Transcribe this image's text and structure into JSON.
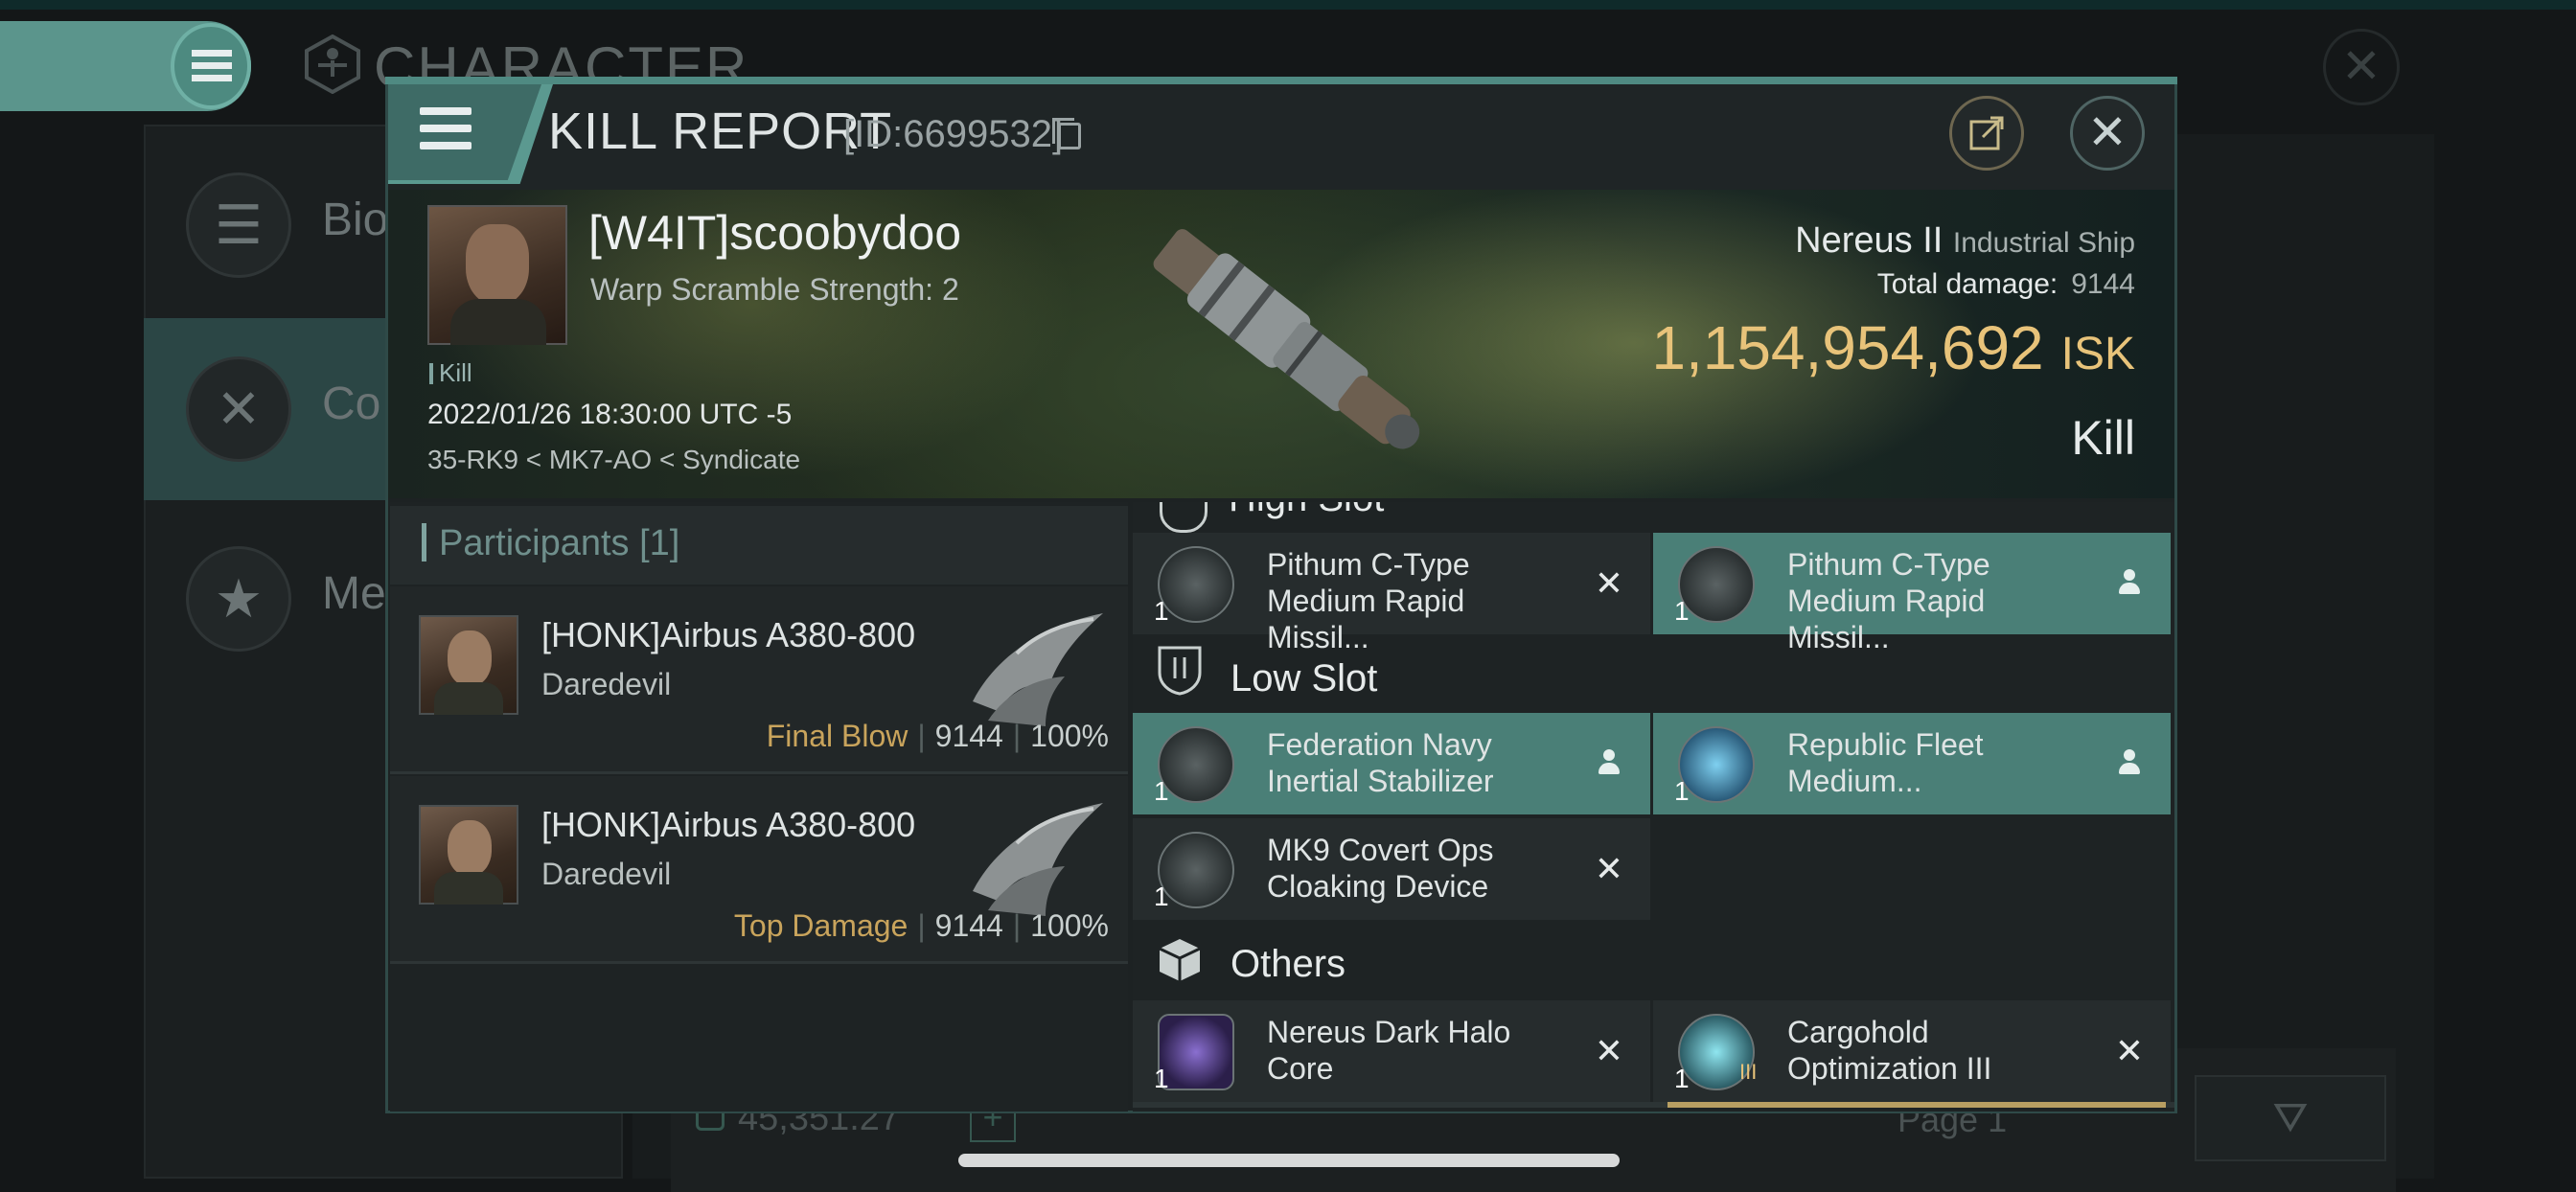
{
  "background": {
    "title": "CHARACTER",
    "sidebar": [
      {
        "label": "Bio",
        "icon": "menu-icon"
      },
      {
        "label": "Co",
        "icon": "crossed-swords-icon"
      },
      {
        "label": "Me",
        "icon": "star-icon"
      }
    ],
    "wallet_value": "45,351.27",
    "page_label": "Page 1"
  },
  "modal": {
    "title": "KILL REPORT",
    "id_text": "[ID:6699532]"
  },
  "victim": {
    "name": "[W4IT]scoobydoo",
    "scramble": "Warp Scramble Strength: 2",
    "tag": "Kill",
    "datetime": "2022/01/26 18:30:00 UTC -5",
    "location": "35-RK9 < MK7-AO < Syndicate"
  },
  "ship": {
    "name": "Nereus II",
    "class": "Industrial Ship",
    "total_damage_label": "Total damage:",
    "total_damage": "9144",
    "isk_value": "1,154,954,692",
    "isk_unit": "ISK",
    "result": "Kill"
  },
  "participants": {
    "title": "Participants",
    "count": "[1]",
    "rows": [
      {
        "name": "[HONK]Airbus A380-800",
        "ship": "Daredevil",
        "tag": "Final Blow",
        "damage": "9144",
        "percent": "100%"
      },
      {
        "name": "[HONK]Airbus A380-800",
        "ship": "Daredevil",
        "tag": "Top Damage",
        "damage": "9144",
        "percent": "100%"
      }
    ]
  },
  "fitting": {
    "high_slot_label": "High Slot",
    "high_slot": [
      {
        "name": "Pithum C-Type Medium Rapid Missil...",
        "qty": "1",
        "state": "destroyed"
      },
      {
        "name": "Pithum C-Type Medium Rapid Missil...",
        "qty": "1",
        "state": "dropped"
      }
    ],
    "low_slot_label": "Low Slot",
    "low_slot": [
      {
        "name": "Federation Navy Inertial Stabilizer",
        "qty": "1",
        "state": "dropped"
      },
      {
        "name": "Republic Fleet Medium...",
        "qty": "1",
        "state": "dropped"
      },
      {
        "name": "MK9 Covert Ops Cloaking Device",
        "qty": "1",
        "state": "destroyed"
      }
    ],
    "others_label": "Others",
    "others": [
      {
        "name": "Nereus Dark Halo Core",
        "qty": "1",
        "state": "destroyed"
      },
      {
        "name": "Cargohold Optimization III",
        "qty": "1",
        "state": "destroyed",
        "badge": "III"
      }
    ],
    "destroyed_glyph": "✕"
  },
  "colors": {
    "accent": "#4f8a82",
    "owned_item": "#4a7f77",
    "isk": "#e8c37a",
    "tag_gold": "#c9a45c"
  }
}
